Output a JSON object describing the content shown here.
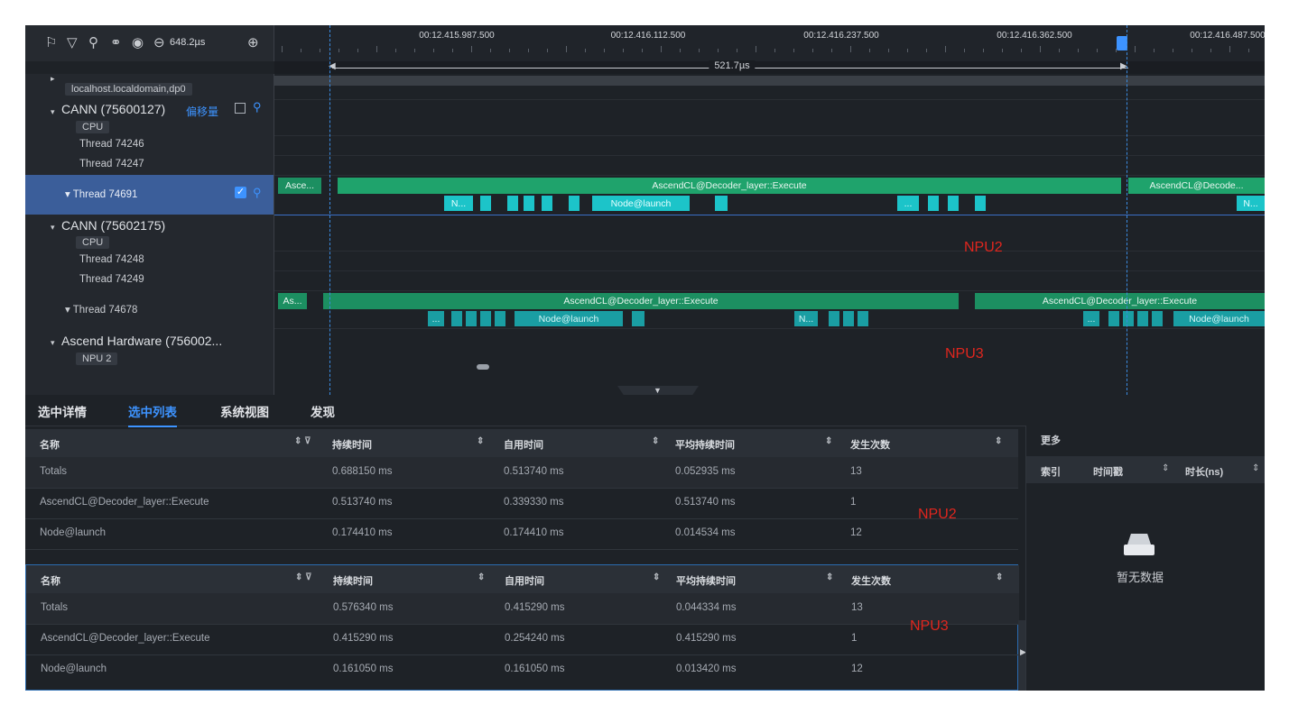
{
  "toolbar": {
    "icons": [
      "flag-icon",
      "filter-icon",
      "search-icon",
      "link-icon",
      "reset-icon",
      "zoom-out-icon",
      "zoom-in-icon"
    ],
    "zoom_value": "648.2µs"
  },
  "ruler": {
    "ticks": [
      "00:12.415.987.500",
      "00:12.416.112.500",
      "00:12.416.237.500",
      "00:12.416.362.500",
      "00:12.416.487.500"
    ],
    "measure_label": "521.7µs"
  },
  "tracks": {
    "host": "localhost.localdomain,dp0",
    "proc1": {
      "name": "CANN (75600127)",
      "offset_label": "偏移量",
      "tag": "CPU",
      "threads": [
        "Thread 74246",
        "Thread 74247"
      ],
      "selected_thread": "Thread 74691"
    },
    "proc2": {
      "name": "CANN (75602175)",
      "tag": "CPU",
      "threads": [
        "Thread 74248",
        "Thread 74249"
      ],
      "expanded_thread": "Thread 74678"
    },
    "proc3": {
      "name": "Ascend Hardware (756002...",
      "tag": "NPU 2"
    }
  },
  "slices": {
    "asce_short": "Asce...",
    "as_short": "As...",
    "execute": "AscendCL@Decoder_layer::Execute",
    "execute_trunc": "AscendCL@Decode...",
    "node_launch": "Node@launch",
    "n_short": "N...",
    "ellipsis": "..."
  },
  "annotations": {
    "npu2": "NPU2",
    "npu3": "NPU3"
  },
  "tabs": [
    "选中详情",
    "选中列表",
    "系统视图",
    "发现"
  ],
  "active_tab": "选中列表",
  "table_headers": [
    "名称",
    "持续时间",
    "自用时间",
    "平均持续时间",
    "发生次数"
  ],
  "table1": [
    [
      "Totals",
      "0.688150 ms",
      "0.513740 ms",
      "0.052935 ms",
      "13"
    ],
    [
      "AscendCL@Decoder_layer::Execute",
      "0.513740 ms",
      "0.339330 ms",
      "0.513740 ms",
      "1"
    ],
    [
      "Node@launch",
      "0.174410 ms",
      "0.174410 ms",
      "0.014534 ms",
      "12"
    ]
  ],
  "table2": [
    [
      "Totals",
      "0.576340 ms",
      "0.415290 ms",
      "0.044334 ms",
      "13"
    ],
    [
      "AscendCL@Decoder_layer::Execute",
      "0.415290 ms",
      "0.254240 ms",
      "0.415290 ms",
      "1"
    ],
    [
      "Node@launch",
      "0.161050 ms",
      "0.161050 ms",
      "0.013420 ms",
      "12"
    ]
  ],
  "right_panel": {
    "title": "更多",
    "headers": [
      "索引",
      "时间戳",
      "时长(ns)"
    ],
    "empty_text": "暂无数据"
  },
  "colors": {
    "accent": "#3d93ff",
    "slice_green": "#1fa36c",
    "slice_cyan": "#1cc4c9",
    "note_red": "#e0261e"
  }
}
